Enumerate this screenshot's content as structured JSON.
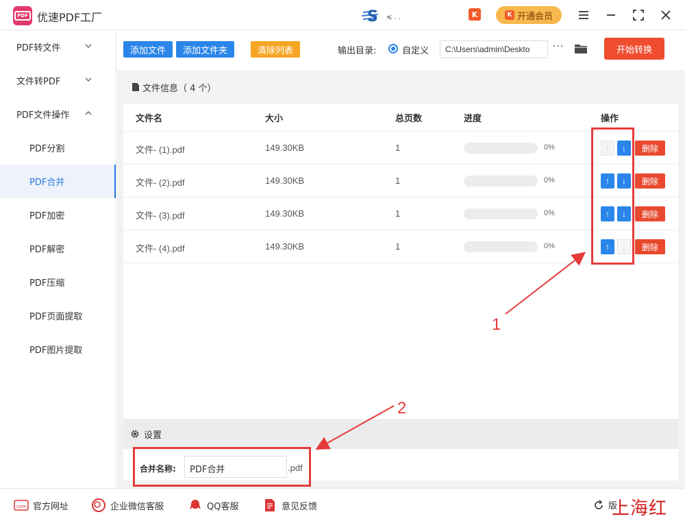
{
  "app": {
    "logo_text": "PDF",
    "title": "优速PDF工厂",
    "center_logo_text": "\"S\"",
    "vip_icon_text": "K",
    "vip_button": "开通会员"
  },
  "sidebar": {
    "groups": [
      {
        "label": "PDF转文件",
        "chevron": "⌄"
      },
      {
        "label": "文件转PDF",
        "chevron": "⌄"
      },
      {
        "label": "PDF文件操作",
        "chevron": "⌃"
      }
    ],
    "subitems": [
      {
        "label": "PDF分割"
      },
      {
        "label": "PDF合并",
        "active": true
      },
      {
        "label": "PDF加密"
      },
      {
        "label": "PDF解密"
      },
      {
        "label": "PDF压缩"
      },
      {
        "label": "PDF页面提取"
      },
      {
        "label": "PDF图片提取"
      }
    ]
  },
  "toolbar": {
    "add_file": "添加文件",
    "add_folder": "添加文件夹",
    "clear_list": "清除列表",
    "output_label": "输出目录:",
    "output_option": "自定义",
    "output_path": "C:\\Users\\admin\\Deskto",
    "more": "···",
    "start": "开始转换"
  },
  "file_panel": {
    "header": "文件信息（ 4 个）",
    "columns": {
      "name": "文件名",
      "size": "大小",
      "pages": "总页数",
      "progress": "进度",
      "actions": "操作"
    },
    "rows": [
      {
        "name": "文件- (1).pdf",
        "size": "149.30KB",
        "pages": "1",
        "progress": "0%",
        "delete": "删除",
        "up_enabled": false,
        "down_enabled": true
      },
      {
        "name": "文件- (2).pdf",
        "size": "149.30KB",
        "pages": "1",
        "progress": "0%",
        "delete": "删除",
        "up_enabled": true,
        "down_enabled": true
      },
      {
        "name": "文件- (3).pdf",
        "size": "149.30KB",
        "pages": "1",
        "progress": "0%",
        "delete": "删除",
        "up_enabled": true,
        "down_enabled": true
      },
      {
        "name": "文件- (4).pdf",
        "size": "149.30KB",
        "pages": "1",
        "progress": "0%",
        "delete": "删除",
        "up_enabled": true,
        "down_enabled": false
      }
    ],
    "progress_fraction": [
      0,
      0,
      0,
      0
    ]
  },
  "settings": {
    "title": "设置",
    "merge_label": "合并名称:",
    "merge_value": "PDF合并",
    "merge_ext": ".pdf"
  },
  "footer": {
    "website": "官方网址",
    "wechat": "企业微信客服",
    "qq": "QQ客服",
    "feedback": "意见反馈",
    "version": "版",
    "watermark": "上海红网"
  },
  "annotations": {
    "label_1": "1",
    "label_2": "2"
  },
  "colors": {
    "accent": "#2a86e8",
    "start": "#ef4d2f",
    "clear": "#f5a623",
    "delete": "#e8492e",
    "annotation": "#e63a3a",
    "active_nav": "#2a7ce0"
  },
  "icons": [
    "app-logo-icon",
    "vip-icon",
    "menu-icon",
    "minimize-icon",
    "maximize-icon",
    "close-icon",
    "folder-icon",
    "file-icon",
    "gear-icon",
    "arrow-up-icon",
    "arrow-down-icon",
    "website-icon",
    "wechat-icon",
    "qq-icon",
    "feedback-icon",
    "refresh-icon"
  ]
}
